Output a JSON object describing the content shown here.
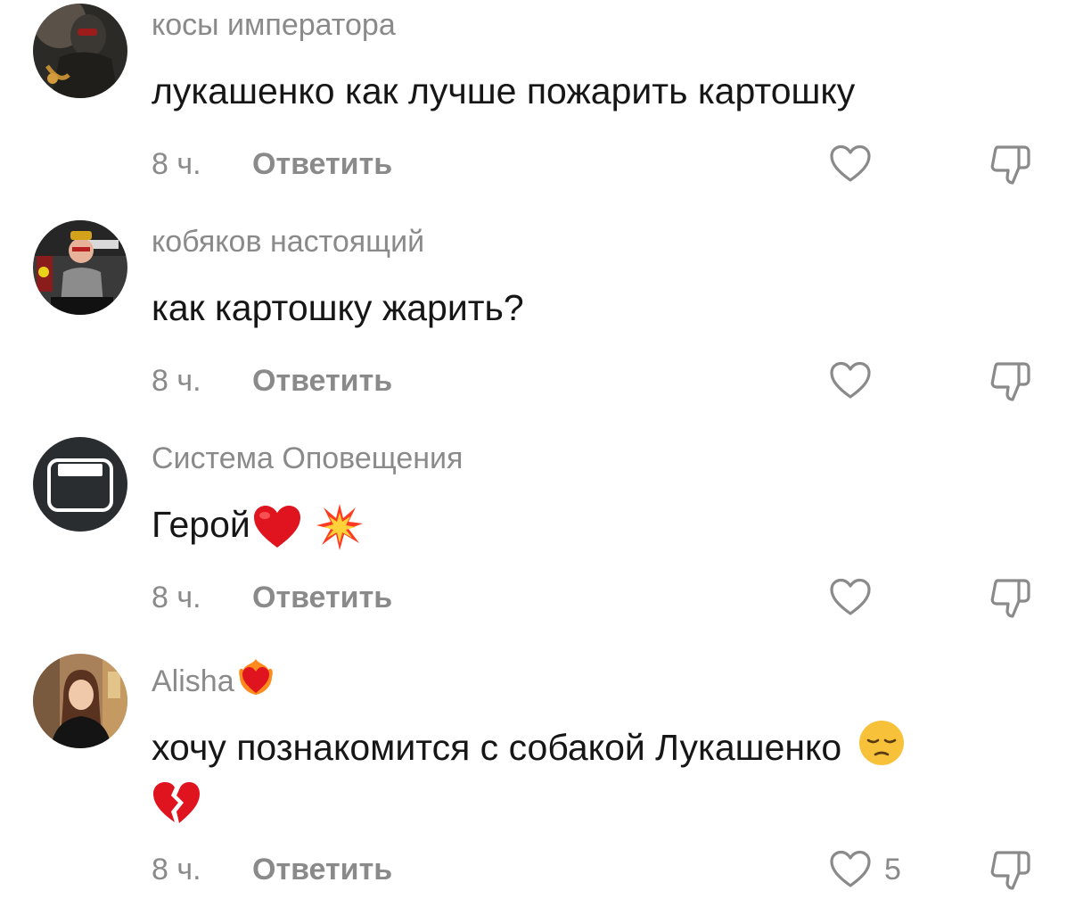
{
  "comments": [
    {
      "username": "косы императора",
      "text": "лукашенко как лучше пожарить картошку",
      "time": "8 ч.",
      "reply_label": "Ответить",
      "avatar_icon": "warrior-avatar"
    },
    {
      "username": "кобяков настоящий",
      "text": "как картошку жарить?",
      "time": "8 ч.",
      "reply_label": "Ответить",
      "avatar_icon": "person-avatar"
    },
    {
      "username": "Система Оповещения",
      "text": "Герой",
      "emojis": [
        "red-heart",
        "collision"
      ],
      "time": "8 ч.",
      "reply_label": "Ответить",
      "avatar_icon": "device-screen-avatar"
    },
    {
      "username": "Alisha",
      "username_emoji": "heart-on-fire",
      "text": "хочу познакомится с собакой Лукашенко",
      "emojis": [
        "pensive-face",
        "broken-heart"
      ],
      "time": "8 ч.",
      "reply_label": "Ответить",
      "like_count": "5",
      "avatar_icon": "girl-avatar"
    }
  ],
  "icons": {
    "like": "heart-outline-icon",
    "dislike": "thumbs-down-outline-icon"
  },
  "colors": {
    "username": "#8a8a8a",
    "text": "#161616",
    "muted": "#8a8a8a"
  }
}
